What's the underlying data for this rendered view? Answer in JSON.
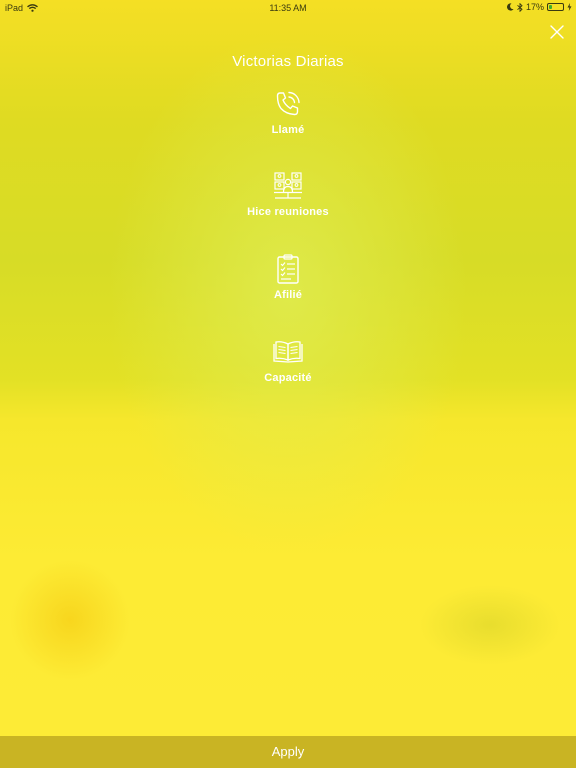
{
  "status_bar": {
    "device": "iPad",
    "time": "11:35 AM",
    "battery_percent": "17%",
    "battery_level": 0.17,
    "icons": [
      "wifi-icon",
      "moon-icon",
      "bluetooth-icon",
      "battery-icon",
      "charging-icon"
    ]
  },
  "header": {
    "title": "Victorias Diarias",
    "close_icon": "close-icon"
  },
  "options": [
    {
      "label": "Llamé",
      "icon": "phone-call-icon"
    },
    {
      "label": "Hice reuniones",
      "icon": "meeting-icon"
    },
    {
      "label": "Afilié",
      "icon": "clipboard-checklist-icon"
    },
    {
      "label": "Capacité",
      "icon": "open-book-icon"
    }
  ],
  "footer": {
    "apply_label": "Apply"
  },
  "colors": {
    "background": "#f6e82a",
    "apply_bar": "#c9b423",
    "text": "#ffffff"
  }
}
